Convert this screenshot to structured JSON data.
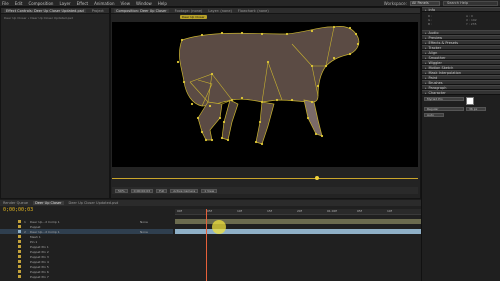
{
  "menu": [
    "File",
    "Edit",
    "Composition",
    "Layer",
    "Effect",
    "Animation",
    "View",
    "Window",
    "Help"
  ],
  "workspace": {
    "label": "Workspace:",
    "value": "All Panels"
  },
  "search": {
    "placeholder": "Search Help"
  },
  "left_panel": {
    "tabs": [
      "Effect Controls: Deer Up Closer Updated.psd",
      "Project"
    ],
    "crumb": "Deer Up Closer • Deer Up Closer Updated.psd"
  },
  "viewer": {
    "tabs": [
      "Composition: Deer Up Closer",
      "Footage: (none)",
      "Layer: (none)",
      "Flowchart: (none)"
    ],
    "comp_chip": "Deer Up Closer",
    "toolbar": [
      "50%",
      "0:00:00:03",
      "Full",
      "Active Camera",
      "1 View"
    ]
  },
  "right_panel": {
    "header_top": "Info",
    "sections": [
      {
        "title": "Audio"
      },
      {
        "title": "Preview"
      },
      {
        "title": "Effects & Presets"
      },
      {
        "title": "Tracker"
      },
      {
        "title": "Align"
      },
      {
        "title": "Smoother"
      },
      {
        "title": "Wiggler"
      },
      {
        "title": "Motion Sketch"
      },
      {
        "title": "Mask Interpolation"
      },
      {
        "title": "Paint"
      },
      {
        "title": "Brushes"
      },
      {
        "title": "Paragraph"
      },
      {
        "title": "Character"
      }
    ],
    "info_rows": [
      "R :",
      "G :",
      "B :",
      "A : 0",
      "X : 192",
      "Y : 235"
    ],
    "character": {
      "font": "Myriad Pro",
      "style": "Regular",
      "size": "36 px",
      "leading": "Auto"
    }
  },
  "timeline": {
    "tabs": [
      "Render Queue",
      "Deer Up Closer",
      "Deer Up Closer Updated.psd"
    ],
    "timecode": "0;00;00;03",
    "ruler": [
      "00f",
      "05f",
      "10f",
      "15f",
      "20f",
      "01:00f",
      "05f",
      "10f"
    ],
    "layers": [
      {
        "num": "1",
        "name": "Deer Up...d Comp 1",
        "parent": "None",
        "color": "#c2a23a"
      },
      {
        "num": "",
        "name": "Puppet",
        "parent": "",
        "color": "#c2a23a"
      },
      {
        "num": "2",
        "name": "Deer Up...d Comp 1",
        "parent": "None",
        "color": "#8fb0c7"
      },
      {
        "num": "",
        "name": "Mesh 1",
        "parent": "",
        "color": "#c2a23a"
      },
      {
        "num": "",
        "name": "Pin 1",
        "parent": "",
        "color": "#c2a23a"
      },
      {
        "num": "",
        "name": "Puppet Pin 1",
        "parent": "",
        "color": "#c2a23a"
      },
      {
        "num": "",
        "name": "Puppet Pin 2",
        "parent": "",
        "color": "#c2a23a"
      },
      {
        "num": "",
        "name": "Puppet Pin 3",
        "parent": "",
        "color": "#c2a23a"
      },
      {
        "num": "",
        "name": "Puppet Pin 4",
        "parent": "",
        "color": "#c2a23a"
      },
      {
        "num": "",
        "name": "Puppet Pin 5",
        "parent": "",
        "color": "#c2a23a"
      },
      {
        "num": "",
        "name": "Puppet Pin 6",
        "parent": "",
        "color": "#c2a23a"
      },
      {
        "num": "",
        "name": "Puppet Pin 7",
        "parent": "",
        "color": "#c2a23a"
      }
    ]
  }
}
